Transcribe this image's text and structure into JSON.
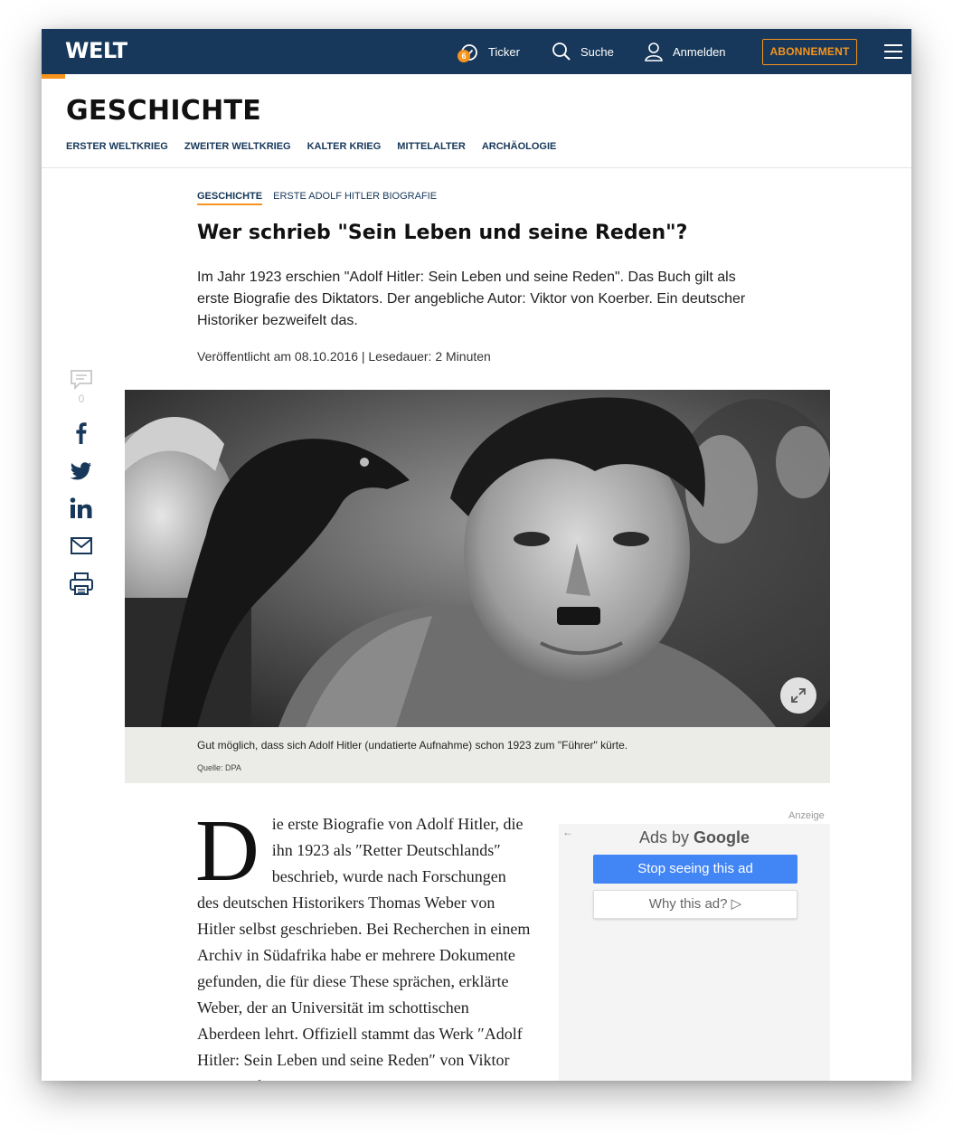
{
  "brand": {
    "logo": "WELT",
    "accent_color": "#f7941d",
    "bar_color": "#17385a"
  },
  "header": {
    "ticker_label": "Ticker",
    "ticker_badge": "6",
    "search_label": "Suche",
    "login_label": "Anmelden",
    "subscribe_label": "ABONNEMENT"
  },
  "section": {
    "title": "GESCHICHTE",
    "subnav": [
      "ERSTER WELTKRIEG",
      "ZWEITER WELTKRIEG",
      "KALTER KRIEG",
      "MITTELALTER",
      "ARCHÄOLOGIE"
    ]
  },
  "article": {
    "breadcrumb_main": "GESCHICHTE",
    "breadcrumb_sub": "ERSTE ADOLF HITLER BIOGRAFIE",
    "headline": "Wer schrieb \"Sein Leben und seine Reden\"?",
    "intro": "Im Jahr 1923 erschien \"Adolf Hitler: Sein Leben und seine Reden\". Das Buch gilt als erste Biografie des Diktators. Der angebliche Autor: Viktor von Koerber. Ein deutscher Historiker bezweifelt das.",
    "meta": "Veröffentlicht am 08.10.2016 | Lesedauer: 2 Minuten",
    "comment_count": "0",
    "caption": "Gut möglich, dass sich Adolf Hitler (undatierte Aufnahme) schon 1923 zum \"Führer\" kürte.",
    "credit": "Quelle: DPA",
    "dropcap": "D",
    "body": "ie erste Biografie von Adolf Hitler, die ihn 1923 als ″Retter Deutschlands″ beschrieb, wurde nach Forschungen des deutschen Historikers Thomas Weber von Hitler selbst geschrieben. Bei Recherchen in einem Archiv in Südafrika habe er mehrere Dokumente gefunden, die für diese These sprächen, erklärte Weber, der an Universität im schottischen Aberdeen lehrt. Offiziell stammt das Werk ″Adolf Hitler: Sein Leben und seine Reden″ von Viktor von Koerber."
  },
  "ad": {
    "label": "Anzeige",
    "back_arrow": "←",
    "ads_by": "Ads by",
    "ads_brand": "Google",
    "stop_label": "Stop seeing this ad",
    "why_label": "Why this ad? ▷"
  }
}
